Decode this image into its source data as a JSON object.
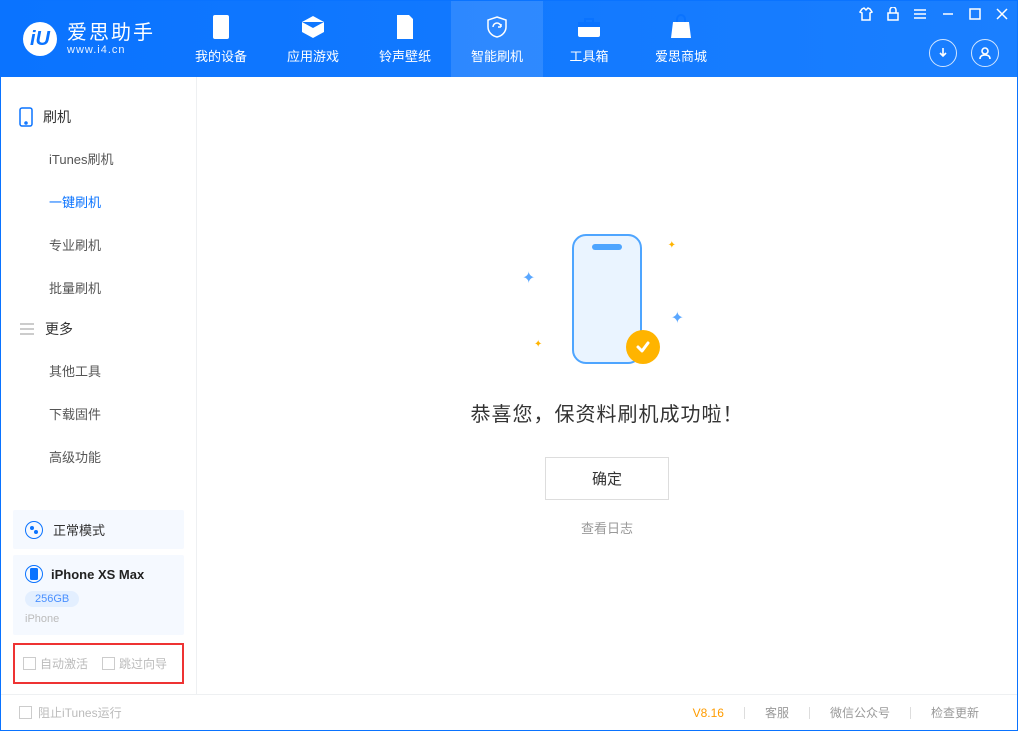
{
  "app": {
    "name": "爱思助手",
    "url": "www.i4.cn"
  },
  "tabs": [
    {
      "label": "我的设备"
    },
    {
      "label": "应用游戏"
    },
    {
      "label": "铃声壁纸"
    },
    {
      "label": "智能刷机"
    },
    {
      "label": "工具箱"
    },
    {
      "label": "爱思商城"
    }
  ],
  "sidebar": {
    "section1": {
      "title": "刷机",
      "items": [
        "iTunes刷机",
        "一键刷机",
        "专业刷机",
        "批量刷机"
      ]
    },
    "section2": {
      "title": "更多",
      "items": [
        "其他工具",
        "下载固件",
        "高级功能"
      ]
    },
    "mode_panel": {
      "label": "正常模式"
    },
    "device_panel": {
      "name": "iPhone XS Max",
      "storage": "256GB",
      "type": "iPhone"
    },
    "checks": {
      "auto_activate": "自动激活",
      "skip_guide": "跳过向导"
    }
  },
  "main": {
    "success_message": "恭喜您，保资料刷机成功啦！",
    "ok_button": "确定",
    "view_log": "查看日志"
  },
  "statusbar": {
    "block_itunes": "阻止iTunes运行",
    "version": "V8.16",
    "links": [
      "客服",
      "微信公众号",
      "检查更新"
    ]
  }
}
